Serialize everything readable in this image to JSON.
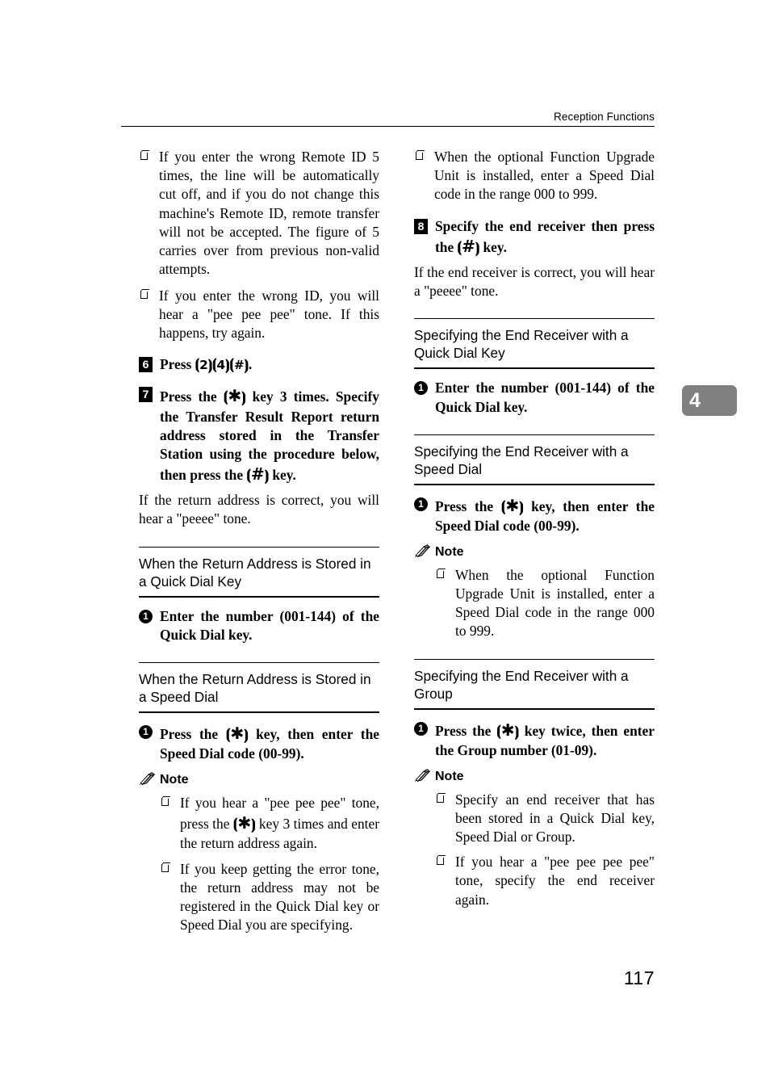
{
  "page": {
    "running_header": "Reception Functions",
    "chapter_tab": "4",
    "folio": "117"
  },
  "left_column": {
    "top_notes": [
      "If you enter the wrong Remote ID 5 times, the line will be automatically cut off, and if you do not change this machine's Remote ID, remote transfer will not be accepted. The figure of 5 carries over from previous non-valid attempts.",
      "If you enter the wrong ID, you will hear a \"pee pee pee\" tone. If this happens, try again."
    ],
    "step6": {
      "number": "6",
      "text_before": "Press ",
      "keys": "[2][4][#]",
      "text_after": "."
    },
    "step7": {
      "number": "7",
      "part1": "Press the ",
      "key1": "[*]",
      "part2": " key 3 times. Specify the Transfer Result Report return address stored in the Transfer Station using the procedure below, then press the ",
      "key2": "[#]",
      "part3": " key.",
      "explanation": "If the return address is correct, you will hear a \"peeee\" tone."
    },
    "section_quick_dial": {
      "title": "When the Return Address is Stored in a Quick Dial Key",
      "substep_number": "1",
      "substep_text": "Enter the number (001-144) of the Quick Dial key."
    },
    "section_speed_dial": {
      "title": "When the Return Address is Stored in a Speed Dial",
      "substep_number": "1",
      "substep_part1": "Press the ",
      "substep_key": "[*]",
      "substep_part2": " key, then enter the Speed Dial code (00-99).",
      "note_label": "Note",
      "notes": [
        {
          "part1": "If you hear a \"pee pee pee\" tone, press the ",
          "key": "[*]",
          "part2": " key 3 times and enter the return address again."
        },
        {
          "part1": "If you keep getting the error tone, the return address may not be registered in the Quick Dial key or Speed Dial you are specifying.",
          "key": "",
          "part2": ""
        }
      ]
    }
  },
  "right_column": {
    "top_notes": [
      "When the optional Function Upgrade Unit is installed, enter a Speed Dial code in the range 000 to 999."
    ],
    "step8": {
      "number": "8",
      "part1": "Specify the end receiver then press the ",
      "key": "[#]",
      "part2": " key.",
      "explanation": "If the end receiver is correct, you will hear a \"peeee\" tone."
    },
    "section_quick_dial": {
      "title": "Specifying the End Receiver with a Quick Dial Key",
      "substep_number": "1",
      "substep_text": "Enter the number (001-144) of the Quick Dial key."
    },
    "section_speed_dial": {
      "title": "Specifying the End Receiver with a Speed Dial",
      "substep_number": "1",
      "substep_part1": "Press the ",
      "substep_key": "[*]",
      "substep_part2": " key, then enter the Speed Dial code (00-99).",
      "note_label": "Note",
      "notes": [
        "When the optional Function Upgrade Unit is installed, enter a Speed Dial code in the range 000 to 999."
      ]
    },
    "section_group": {
      "title": "Specifying the End Receiver with a Group",
      "substep_number": "1",
      "substep_part1": "Press the ",
      "substep_key": "[*]",
      "substep_part2": " key twice, then enter the Group number (01-09).",
      "note_label": "Note",
      "notes": [
        "Specify an end receiver that has been stored in a Quick Dial key, Speed Dial or Group.",
        "If you hear a \"pee pee pee pee\" tone, specify the end receiver again."
      ]
    }
  },
  "icons": {
    "note": "pencil-icon",
    "bullet": "hollow-square-bullet"
  },
  "colors": {
    "text": "#000000",
    "chapter_tab_bg": "#808080",
    "chapter_tab_fg": "#ffffff",
    "page_bg": "#ffffff"
  }
}
